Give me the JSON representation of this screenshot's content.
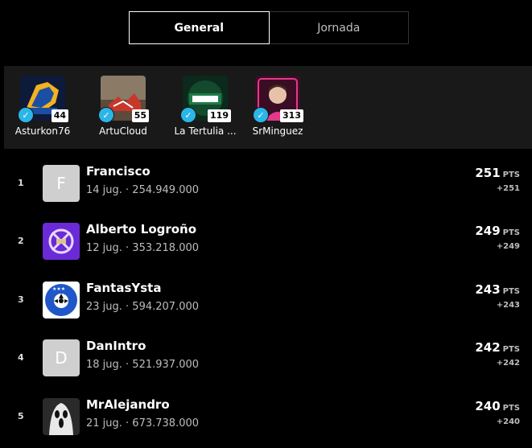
{
  "tabs": {
    "general": "General",
    "jornada": "Jornada"
  },
  "favorites": [
    {
      "name": "Asturkon76",
      "count": "44"
    },
    {
      "name": "ArtuCloud",
      "count": "55"
    },
    {
      "name": "La Tertulia ...",
      "count": "119"
    },
    {
      "name": "SrMinguez",
      "count": "313"
    }
  ],
  "ranking": [
    {
      "rank": "1",
      "name": "Francisco",
      "letter": "F",
      "sub": "14 jug. · 254.949.000",
      "points": "251",
      "unit": "PTS",
      "delta": "+251"
    },
    {
      "rank": "2",
      "name": "Alberto Logroño",
      "letter": "",
      "sub": "12 jug. · 353.218.000",
      "points": "249",
      "unit": "PTS",
      "delta": "+249"
    },
    {
      "rank": "3",
      "name": "FantasYsta",
      "letter": "",
      "sub": "23 jug. · 594.207.000",
      "points": "243",
      "unit": "PTS",
      "delta": "+243"
    },
    {
      "rank": "4",
      "name": "DanIntro",
      "letter": "D",
      "sub": "18 jug. · 521.937.000",
      "points": "242",
      "unit": "PTS",
      "delta": "+242"
    },
    {
      "rank": "5",
      "name": "MrAlejandro",
      "letter": "",
      "sub": "21 jug. · 673.738.000",
      "points": "240",
      "unit": "PTS",
      "delta": "+240"
    }
  ],
  "colors": {
    "verified": "#2bb6e8",
    "strip": "#191919",
    "background": "#000000"
  }
}
